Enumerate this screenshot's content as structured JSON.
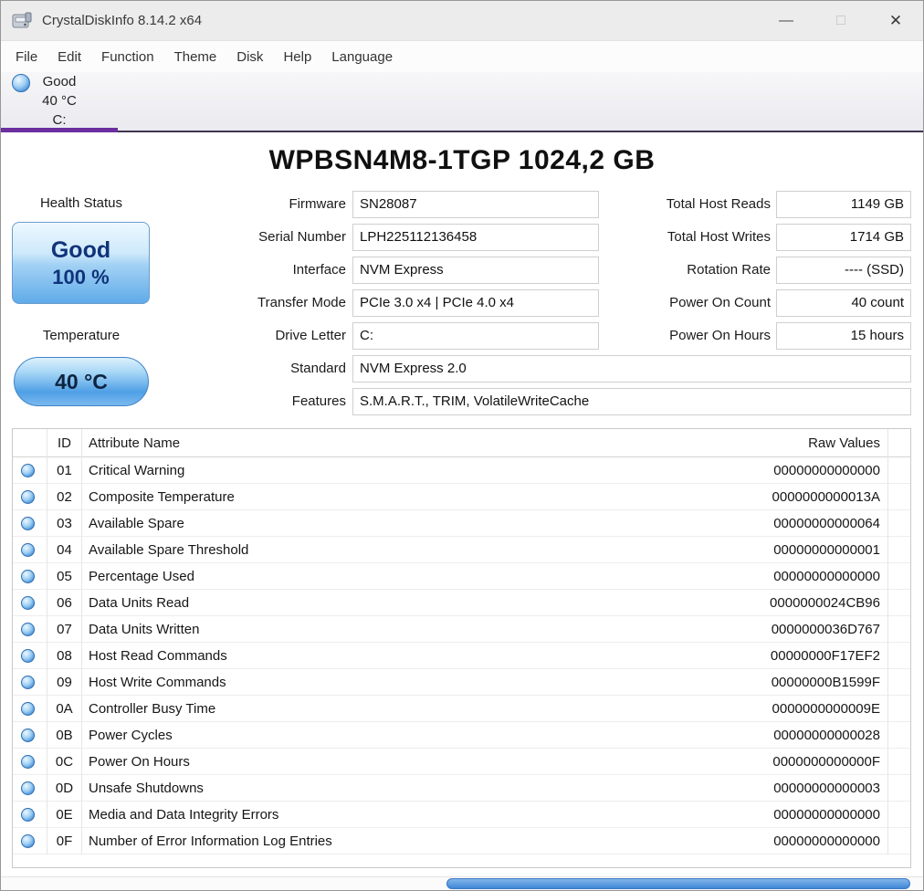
{
  "window": {
    "title": "CrystalDiskInfo 8.14.2 x64",
    "controls": {
      "minimize": "—",
      "maximize": "□",
      "close": "✕"
    }
  },
  "menu": {
    "items": [
      "File",
      "Edit",
      "Function",
      "Theme",
      "Disk",
      "Help",
      "Language"
    ]
  },
  "drive_tab": {
    "status": "Good",
    "temperature": "40 °C",
    "letter": "C:"
  },
  "main": {
    "title": "WPBSN4M8-1TGP 1024,2 GB",
    "health": {
      "label": "Health Status",
      "status": "Good",
      "percent": "100 %"
    },
    "temperature": {
      "label": "Temperature",
      "value": "40 °C"
    },
    "info_fields": [
      {
        "label": "Firmware",
        "value": "SN28087"
      },
      {
        "label": "Serial Number",
        "value": "LPH225112136458"
      },
      {
        "label": "Interface",
        "value": "NVM Express"
      },
      {
        "label": "Transfer Mode",
        "value": "PCIe 3.0 x4 | PCIe 4.0 x4"
      },
      {
        "label": "Drive Letter",
        "value": "C:"
      },
      {
        "label": "Standard",
        "value": "NVM Express 2.0"
      },
      {
        "label": "Features",
        "value": "S.M.A.R.T., TRIM, VolatileWriteCache"
      }
    ],
    "stats_fields": [
      {
        "label": "Total Host Reads",
        "value": "1149 GB"
      },
      {
        "label": "Total Host Writes",
        "value": "1714 GB"
      },
      {
        "label": "Rotation Rate",
        "value": "---- (SSD)"
      },
      {
        "label": "Power On Count",
        "value": "40 count"
      },
      {
        "label": "Power On Hours",
        "value": "15 hours"
      }
    ]
  },
  "smart_table": {
    "headers": {
      "id": "ID",
      "name": "Attribute Name",
      "raw": "Raw Values"
    },
    "rows": [
      {
        "id": "01",
        "name": "Critical Warning",
        "raw": "00000000000000"
      },
      {
        "id": "02",
        "name": "Composite Temperature",
        "raw": "0000000000013A"
      },
      {
        "id": "03",
        "name": "Available Spare",
        "raw": "00000000000064"
      },
      {
        "id": "04",
        "name": "Available Spare Threshold",
        "raw": "00000000000001"
      },
      {
        "id": "05",
        "name": "Percentage Used",
        "raw": "00000000000000"
      },
      {
        "id": "06",
        "name": "Data Units Read",
        "raw": "0000000024CB96"
      },
      {
        "id": "07",
        "name": "Data Units Written",
        "raw": "0000000036D767"
      },
      {
        "id": "08",
        "name": "Host Read Commands",
        "raw": "00000000F17EF2"
      },
      {
        "id": "09",
        "name": "Host Write Commands",
        "raw": "00000000B1599F"
      },
      {
        "id": "0A",
        "name": "Controller Busy Time",
        "raw": "0000000000009E"
      },
      {
        "id": "0B",
        "name": "Power Cycles",
        "raw": "00000000000028"
      },
      {
        "id": "0C",
        "name": "Power On Hours",
        "raw": "0000000000000F"
      },
      {
        "id": "0D",
        "name": "Unsafe Shutdowns",
        "raw": "00000000000003"
      },
      {
        "id": "0E",
        "name": "Media and Data Integrity Errors",
        "raw": "00000000000000"
      },
      {
        "id": "0F",
        "name": "Number of Error Information Log Entries",
        "raw": "00000000000000"
      }
    ]
  },
  "icons": {
    "app": "disk-drive-icon",
    "tab_status": "blue-circle-good",
    "row_status": "blue-circle-good"
  },
  "colors": {
    "accent_purple": "#6b2fa0",
    "health_button_blue": "#5fabe9",
    "status_dot_blue": "#3f8ad6",
    "scrollbar_thumb_blue": "#3f86d8"
  }
}
